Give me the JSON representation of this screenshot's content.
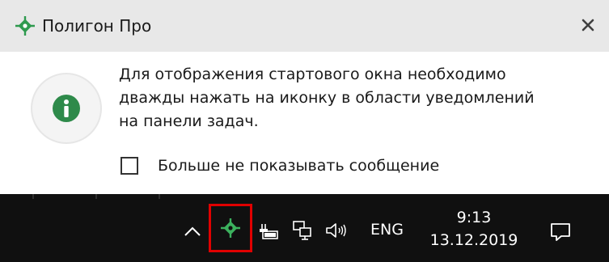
{
  "balloon": {
    "title": "Полигон Про",
    "icon": "polygon-pro-app-icon",
    "close_icon": "close-icon",
    "info_icon": "info-icon",
    "message_lines": [
      "Для отображения стартового окна необходимо",
      "дважды нажать на иконку в области уведомлений",
      "на панели задач."
    ],
    "checkbox": {
      "label": "Больше не показывать сообщение",
      "checked": false
    }
  },
  "taskbar": {
    "language": "ENG",
    "time": "9:13",
    "date": "13.12.2019",
    "icons": [
      "show-hidden-icons-chevron-icon",
      "polygon-pro-tray-icon",
      "battery-icon",
      "network-icon",
      "volume-icon",
      "action-center-icon"
    ],
    "highlight_color": "#e00000"
  },
  "colors": {
    "accent_green": "#2e9a4e",
    "header_bg": "#e8e8e8",
    "taskbar_bg": "#101010"
  }
}
